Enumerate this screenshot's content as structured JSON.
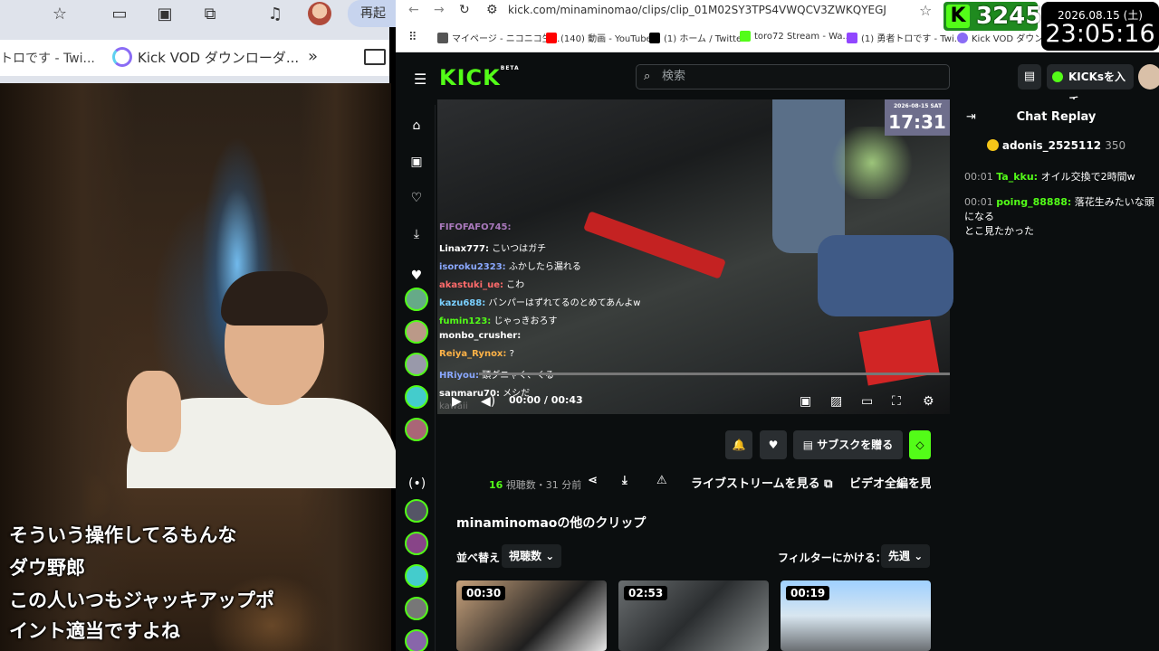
{
  "left_browser": {
    "restart_label": "再起",
    "tab1_label": "トロです - Twi...",
    "tab2_label": "Kick VOD ダウンローダ...",
    "chevron": "»"
  },
  "subtitles": [
    "そういう操作してるもんな",
    "ダウ野郎",
    "この人いつもジャッキアップポ",
    "イント適当ですよね"
  ],
  "right_browser": {
    "url": "kick.com/minaminomao/clips/clip_01M02SY3TPS4VWQCV3ZWKQYEGJ",
    "bookmarks": [
      {
        "label": "マイページ - ニコニコ生...",
        "color": "#555555"
      },
      {
        "label": "(140) 動画 - YouTube",
        "color": "#ff0000"
      },
      {
        "label": "(1) ホーム / Twitter",
        "color": "#000000"
      },
      {
        "label": "toro72 Stream - Wa...",
        "color": "#53fc18"
      },
      {
        "label": "(1) 勇者トロです - Twi...",
        "color": "#9146ff"
      },
      {
        "label": "Kick VOD ダウンロー",
        "color": "#8a6cf5"
      }
    ]
  },
  "kick": {
    "logo": "KICK",
    "logo_beta": "BETA",
    "search_placeholder": "検索",
    "kicks_button": "KICKsを入手",
    "video_timestamp": "17:31",
    "video_date": "2026-08-15 SAT",
    "time_display": "00:00 / 00:43",
    "overlay_chat": [
      {
        "user": "FIFOFAFO745:",
        "text": "",
        "color": "#e6a0ff"
      },
      {
        "user": "Linax777:",
        "text": "こいつはガチ",
        "color": "#ffffff"
      },
      {
        "user": "isoroku2323:",
        "text": "ふかしたら漏れる",
        "color": "#8aa8ff"
      },
      {
        "user": "akastuki_ue:",
        "text": "こわ",
        "color": "#ff6b6b"
      },
      {
        "user": "kazu688:",
        "text": "バンパーはずれてるのとめてあんよw",
        "color": "#7ad0ff"
      },
      {
        "user": "fumin123:",
        "text": "じゃっきおろす",
        "color": "#53fc18"
      },
      {
        "user": "monbo_crusher:",
        "text": "",
        "color": "#ffffff"
      },
      {
        "user": "Reiya_Rynox:",
        "text": "?",
        "color": "#ffb347"
      },
      {
        "user": "HRiyou:",
        "text": "頭グニャく、くる",
        "color": "#8aa8ff"
      },
      {
        "user": "sanmaru70:",
        "text": "メシだ",
        "color": "#ffffff"
      },
      {
        "user": "",
        "text": "kawaii",
        "color": "#777777"
      }
    ],
    "subscribe_button": "サブスクを贈る",
    "stats_views": "16",
    "stats_text": "視聴数・31 分前",
    "livestream_link": "ライブストリームを見る",
    "fullvideo_link": "ビデオ全編を見る",
    "other_clips_title": "minaminomaoの他のクリップ",
    "sort_label": "並べ替え",
    "sort_value": "視聴数",
    "filter_label": "フィルターにかける：",
    "filter_value": "先週",
    "clips": [
      {
        "duration": "00:30"
      },
      {
        "duration": "02:53"
      },
      {
        "duration": "00:19"
      }
    ]
  },
  "chat": {
    "title": "Chat Replay",
    "top_user": "adonis_2525112",
    "top_count": "350",
    "messages": [
      {
        "time": "00:01",
        "user": "Ta_kku:",
        "text": "オイル交換で2時間w"
      },
      {
        "time": "00:01",
        "user": "poing_88888:",
        "text": "落花生みたいな頭になる\nとこ見たかった"
      }
    ]
  },
  "overlay": {
    "kicks_count": "3245",
    "date": "2026.08.15 (土)",
    "time": "23:05:16"
  },
  "colors": {
    "kick_green": "#53fc18",
    "kick_bg": "#0b0e0f"
  }
}
